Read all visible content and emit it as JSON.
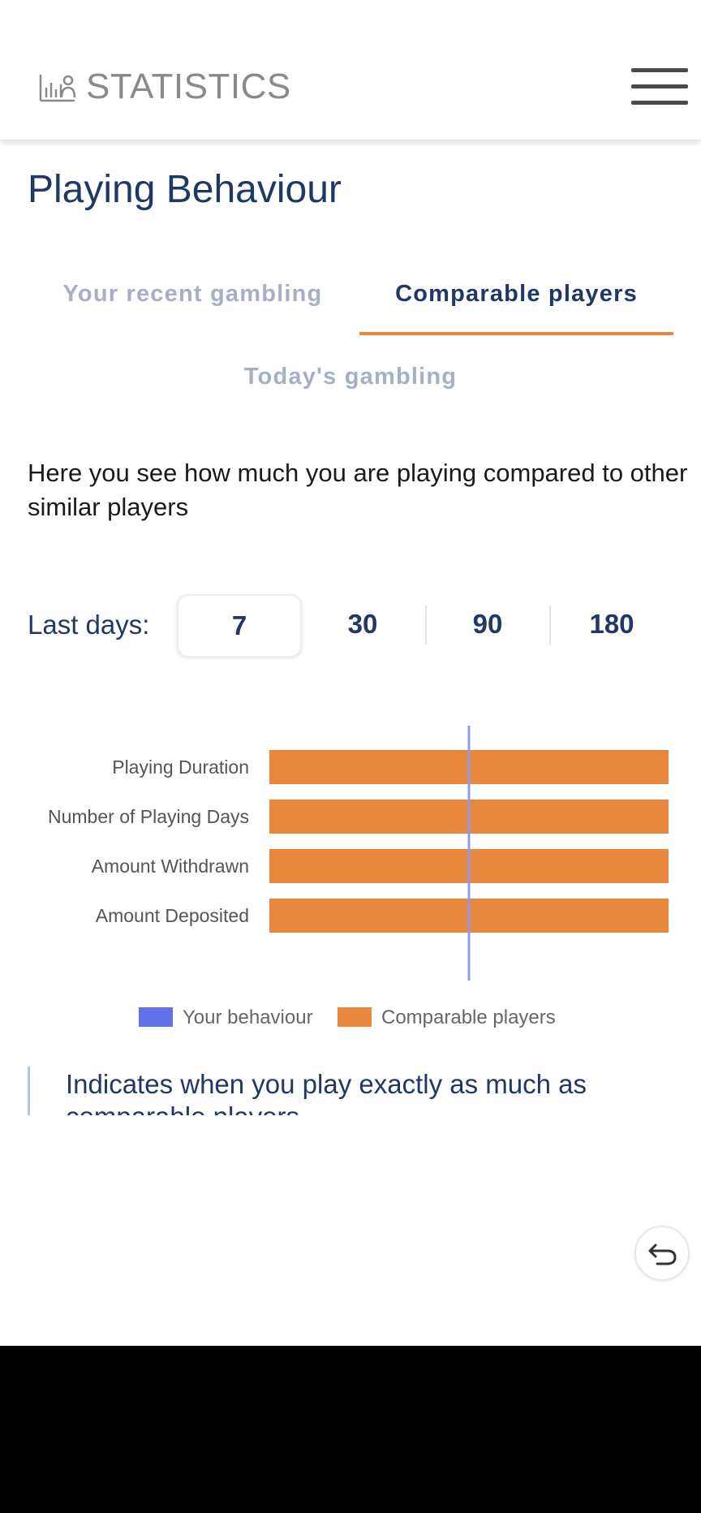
{
  "header": {
    "logo_icon": "bar-chart-person-icon",
    "app_title": "STATISTICS",
    "menu_icon": "hamburger-menu-icon"
  },
  "page": {
    "title": "Playing Behaviour"
  },
  "tabs": [
    {
      "label": "Your recent gambling",
      "active": false
    },
    {
      "label": "Comparable players",
      "active": true
    },
    {
      "label": "Today's gambling",
      "active": false
    }
  ],
  "description": "Here you see how much you are playing compared to other similar players",
  "period": {
    "label": "Last days:",
    "options": [
      "7",
      "30",
      "90",
      "180"
    ],
    "selected": "7"
  },
  "chart_data": {
    "type": "bar",
    "orientation": "horizontal",
    "categories": [
      "Playing Duration",
      "Number of Playing Days",
      "Amount Withdrawn",
      "Amount Deposited"
    ],
    "series": [
      {
        "name": "Your behaviour",
        "color": "#6272ea",
        "style": "reference-line",
        "values": [
          0,
          0,
          0,
          0
        ]
      },
      {
        "name": "Comparable players",
        "color": "#e8873e",
        "values": [
          1,
          1,
          1,
          1
        ]
      }
    ],
    "xlim": [
      -1,
      1
    ],
    "legend": "bottom-center",
    "grid": false
  },
  "note": {
    "text": "Indicates when you play exactly as much as comparable players"
  },
  "controls": {
    "back_icon": "back-arrow-icon"
  },
  "colors": {
    "accent": "#e8873e",
    "navy": "#1f3864",
    "muted_tab": "#a6afc4",
    "reference_line": "#8c9bf0"
  }
}
